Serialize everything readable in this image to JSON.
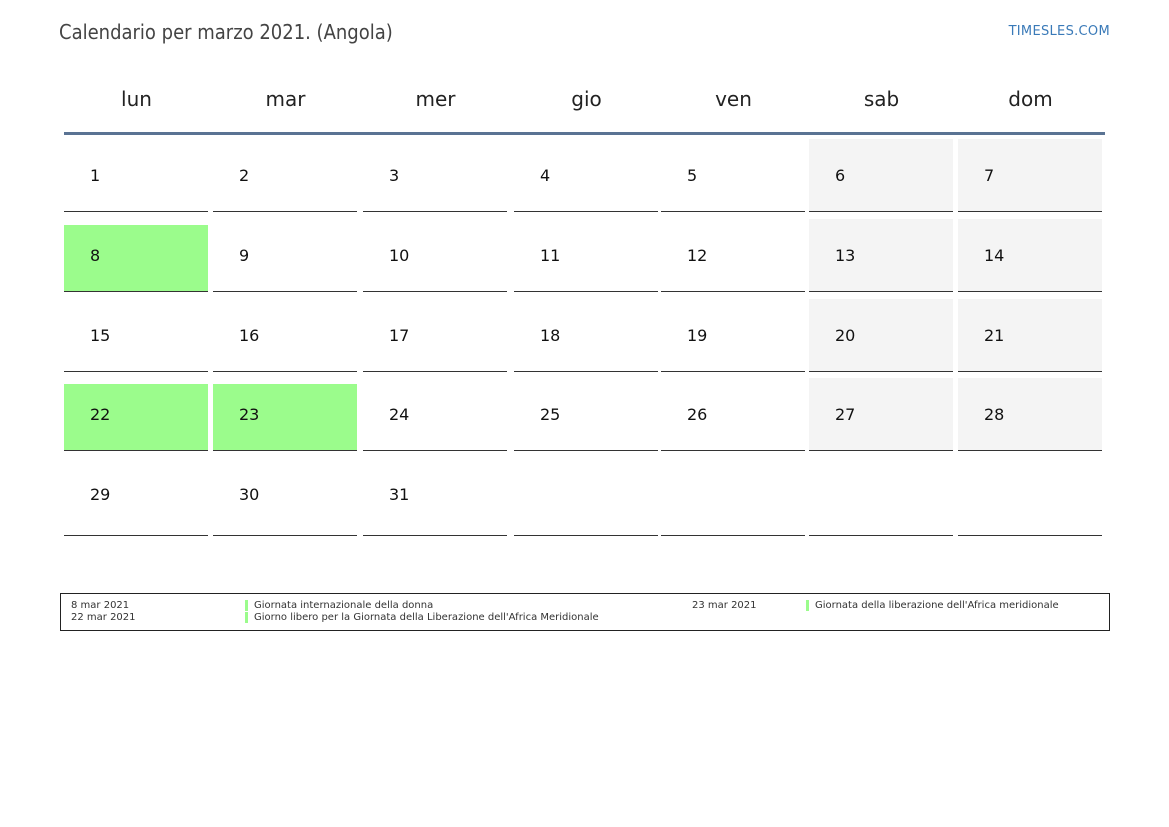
{
  "header": {
    "title": "Calendario per marzo 2021. (Angola)",
    "brand": "TIMESLES.COM"
  },
  "weekdays": [
    "lun",
    "mar",
    "mer",
    "gio",
    "ven",
    "sab",
    "dom"
  ],
  "weeks": [
    [
      "1",
      "2",
      "3",
      "4",
      "5",
      "6",
      "7"
    ],
    [
      "8",
      "9",
      "10",
      "11",
      "12",
      "13",
      "14"
    ],
    [
      "15",
      "16",
      "17",
      "18",
      "19",
      "20",
      "21"
    ],
    [
      "22",
      "23",
      "24",
      "25",
      "26",
      "27",
      "28"
    ],
    [
      "29",
      "30",
      "31",
      "",
      "",
      "",
      ""
    ]
  ],
  "holiday_days": [
    "8",
    "22",
    "23"
  ],
  "colors": {
    "holiday": "#9bfc8c",
    "weekend": "#f4f4f4",
    "header_rule": "#5a7393",
    "brand": "#3a7ab8"
  },
  "legend": [
    {
      "date": "8 mar 2021",
      "name": "Giornata internazionale della donna"
    },
    {
      "date": "22 mar 2021",
      "name": "Giorno libero per la Giornata della Liberazione dell'Africa Meridionale"
    },
    {
      "date": "23 mar 2021",
      "name": "Giornata della liberazione dell'Africa meridionale"
    }
  ]
}
